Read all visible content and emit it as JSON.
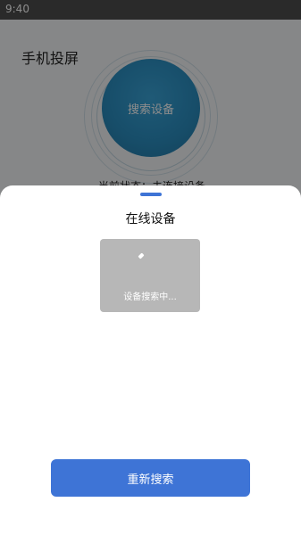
{
  "status_bar": {
    "time": "9:40"
  },
  "page": {
    "title": "手机投屏",
    "search_button_label": "搜索设备",
    "status_text": "当前状态：未连接设备"
  },
  "sheet": {
    "title": "在线设备",
    "card_status": "设备搜索中...",
    "refresh_button_label": "重新搜索"
  },
  "colors": {
    "accent": "#3e74d6",
    "circle": "#2b8fc2",
    "card": "#b7b7b7"
  }
}
